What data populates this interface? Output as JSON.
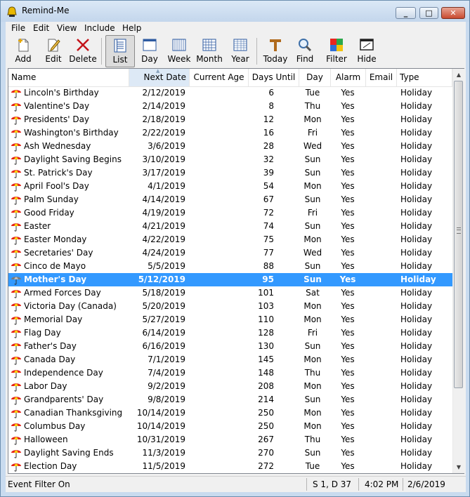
{
  "window": {
    "title": "Remind-Me"
  },
  "menu": [
    "File",
    "Edit",
    "View",
    "Include",
    "Help"
  ],
  "toolbar": {
    "add": "Add",
    "edit": "Edit",
    "delete": "Delete",
    "list": "List",
    "day": "Day",
    "week": "Week",
    "month": "Month",
    "year": "Year",
    "today": "Today",
    "find": "Find",
    "filter": "Filter",
    "hide": "Hide"
  },
  "columns": {
    "name": "Name",
    "next_date": "Next Date",
    "current_age": "Current Age",
    "days_until": "Days Until",
    "day": "Day",
    "alarm": "Alarm",
    "email": "Email",
    "type": "Type"
  },
  "sorted_column": "Next Date",
  "selected_row": 14,
  "rows": [
    {
      "name": "Lincoln's Birthday",
      "date": "2/12/2019",
      "until": "6",
      "day": "Tue",
      "alarm": "Yes",
      "type": "Holiday"
    },
    {
      "name": "Valentine's Day",
      "date": "2/14/2019",
      "until": "8",
      "day": "Thu",
      "alarm": "Yes",
      "type": "Holiday"
    },
    {
      "name": "Presidents' Day",
      "date": "2/18/2019",
      "until": "12",
      "day": "Mon",
      "alarm": "Yes",
      "type": "Holiday"
    },
    {
      "name": "Washington's Birthday",
      "date": "2/22/2019",
      "until": "16",
      "day": "Fri",
      "alarm": "Yes",
      "type": "Holiday"
    },
    {
      "name": "Ash Wednesday",
      "date": "3/6/2019",
      "until": "28",
      "day": "Wed",
      "alarm": "Yes",
      "type": "Holiday"
    },
    {
      "name": "Daylight Saving Begins",
      "date": "3/10/2019",
      "until": "32",
      "day": "Sun",
      "alarm": "Yes",
      "type": "Holiday"
    },
    {
      "name": "St. Patrick's Day",
      "date": "3/17/2019",
      "until": "39",
      "day": "Sun",
      "alarm": "Yes",
      "type": "Holiday"
    },
    {
      "name": "April Fool's Day",
      "date": "4/1/2019",
      "until": "54",
      "day": "Mon",
      "alarm": "Yes",
      "type": "Holiday"
    },
    {
      "name": "Palm Sunday",
      "date": "4/14/2019",
      "until": "67",
      "day": "Sun",
      "alarm": "Yes",
      "type": "Holiday"
    },
    {
      "name": "Good Friday",
      "date": "4/19/2019",
      "until": "72",
      "day": "Fri",
      "alarm": "Yes",
      "type": "Holiday"
    },
    {
      "name": "Easter",
      "date": "4/21/2019",
      "until": "74",
      "day": "Sun",
      "alarm": "Yes",
      "type": "Holiday"
    },
    {
      "name": "Easter Monday",
      "date": "4/22/2019",
      "until": "75",
      "day": "Mon",
      "alarm": "Yes",
      "type": "Holiday"
    },
    {
      "name": "Secretaries' Day",
      "date": "4/24/2019",
      "until": "77",
      "day": "Wed",
      "alarm": "Yes",
      "type": "Holiday"
    },
    {
      "name": "Cinco de Mayo",
      "date": "5/5/2019",
      "until": "88",
      "day": "Sun",
      "alarm": "Yes",
      "type": "Holiday"
    },
    {
      "name": "Mother's Day",
      "date": "5/12/2019",
      "until": "95",
      "day": "Sun",
      "alarm": "Yes",
      "type": "Holiday"
    },
    {
      "name": "Armed Forces Day",
      "date": "5/18/2019",
      "until": "101",
      "day": "Sat",
      "alarm": "Yes",
      "type": "Holiday"
    },
    {
      "name": "Victoria Day (Canada)",
      "date": "5/20/2019",
      "until": "103",
      "day": "Mon",
      "alarm": "Yes",
      "type": "Holiday"
    },
    {
      "name": "Memorial Day",
      "date": "5/27/2019",
      "until": "110",
      "day": "Mon",
      "alarm": "Yes",
      "type": "Holiday"
    },
    {
      "name": "Flag Day",
      "date": "6/14/2019",
      "until": "128",
      "day": "Fri",
      "alarm": "Yes",
      "type": "Holiday"
    },
    {
      "name": "Father's Day",
      "date": "6/16/2019",
      "until": "130",
      "day": "Sun",
      "alarm": "Yes",
      "type": "Holiday"
    },
    {
      "name": "Canada Day",
      "date": "7/1/2019",
      "until": "145",
      "day": "Mon",
      "alarm": "Yes",
      "type": "Holiday"
    },
    {
      "name": "Independence Day",
      "date": "7/4/2019",
      "until": "148",
      "day": "Thu",
      "alarm": "Yes",
      "type": "Holiday"
    },
    {
      "name": "Labor Day",
      "date": "9/2/2019",
      "until": "208",
      "day": "Mon",
      "alarm": "Yes",
      "type": "Holiday"
    },
    {
      "name": "Grandparents' Day",
      "date": "9/8/2019",
      "until": "214",
      "day": "Sun",
      "alarm": "Yes",
      "type": "Holiday"
    },
    {
      "name": "Canadian Thanksgiving",
      "date": "10/14/2019",
      "until": "250",
      "day": "Mon",
      "alarm": "Yes",
      "type": "Holiday"
    },
    {
      "name": "Columbus Day",
      "date": "10/14/2019",
      "until": "250",
      "day": "Mon",
      "alarm": "Yes",
      "type": "Holiday"
    },
    {
      "name": "Halloween",
      "date": "10/31/2019",
      "until": "267",
      "day": "Thu",
      "alarm": "Yes",
      "type": "Holiday"
    },
    {
      "name": "Daylight Saving Ends",
      "date": "11/3/2019",
      "until": "270",
      "day": "Sun",
      "alarm": "Yes",
      "type": "Holiday"
    },
    {
      "name": "Election Day",
      "date": "11/5/2019",
      "until": "272",
      "day": "Tue",
      "alarm": "Yes",
      "type": "Holiday"
    }
  ],
  "status": {
    "filter": "Event Filter On",
    "position": "S 1, D 37",
    "time": "4:02 PM",
    "date": "2/6/2019"
  },
  "icons": {
    "row_icon": "umbrella-icon",
    "app_icon": "bell-icon"
  },
  "colors": {
    "selection": "#3399ff",
    "umbrella_red": "#e3231b",
    "umbrella_yellow": "#ffd400"
  }
}
